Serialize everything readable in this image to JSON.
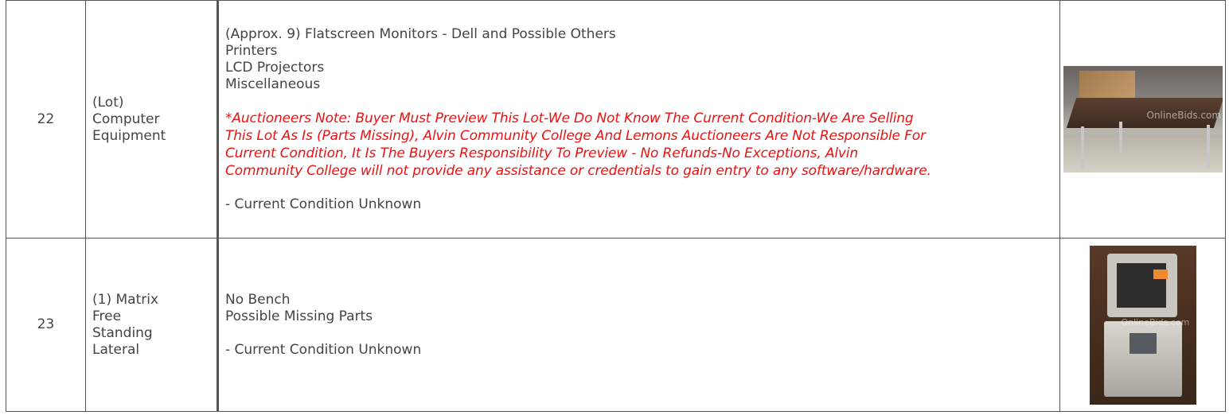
{
  "lots": [
    {
      "number": "22",
      "title_lines": [
        "(Lot)",
        "Computer",
        "Equipment"
      ],
      "items": [
        "(Approx. 9) Flatscreen Monitors - Dell and Possible Others",
        "Printers",
        "LCD Projectors",
        "Miscellaneous"
      ],
      "note_lines": [
        "*Auctioneers Note: Buyer Must Preview This Lot-We Do Not Know The Current Condition-We Are Selling",
        "This Lot As Is (Parts Missing), Alvin Community College And Lemons Auctioneers Are Not Responsible For",
        "Current Condition, It Is The Buyers Responsibility To Preview - No Refunds-No Exceptions, Alvin",
        "Community College will not provide any assistance or credentials to gain entry to any software/hardware."
      ],
      "condition": "- Current Condition Unknown",
      "photo_watermark": "OnlineBids.com"
    },
    {
      "number": "23",
      "title_lines": [
        "(1) Matrix",
        "Free",
        "Standing",
        "Lateral"
      ],
      "items": [
        "No Bench",
        "Possible Missing Parts"
      ],
      "condition": "- Current Condition Unknown",
      "photo_watermark": "OnlineBids.com"
    }
  ],
  "colors": {
    "text": "#444444",
    "note": "#ee1111",
    "border": "#555555"
  }
}
